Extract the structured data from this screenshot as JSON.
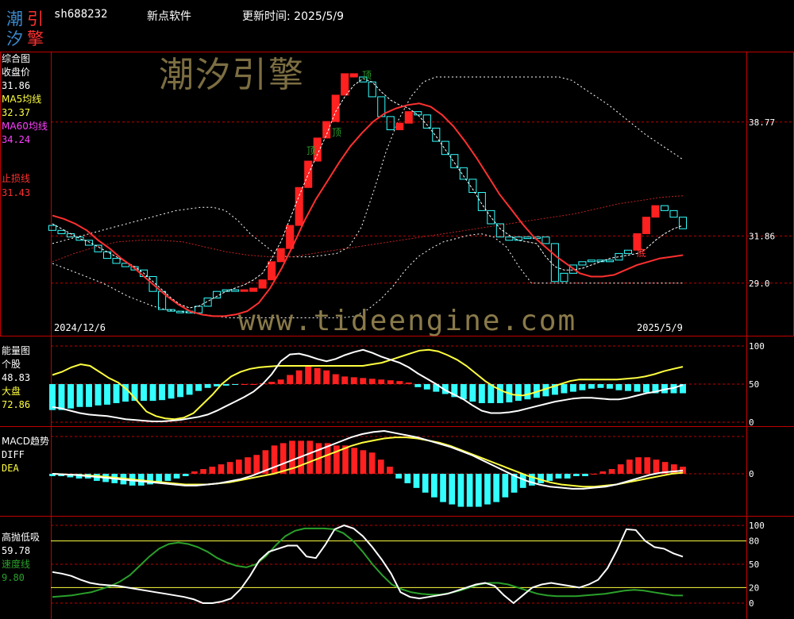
{
  "header": {
    "logo_chars": [
      "潮",
      "引",
      "汐",
      "擎"
    ],
    "code": "sh688232",
    "software": "新点软件",
    "update_label": "更新时间: 2025/5/9"
  },
  "watermarks": {
    "cn": "潮汐引擎",
    "url": "www.tideengine.com"
  },
  "colors": {
    "up": "#ff2020",
    "down": "#33ffff",
    "ma5": "#ffff40",
    "ma60": "#ff3030",
    "grid": "#c00000",
    "white": "#ffffff",
    "green": "#2aa02a"
  },
  "panels": {
    "main": {
      "title": "综合图",
      "close_label": "收盘价",
      "close_value": "31.86",
      "ma5_label": "MA5均线",
      "ma5_value": "32.37",
      "ma60_label": "MA60均线",
      "ma60_value": "34.24",
      "stop_label": "止损线",
      "stop_value": "31.43",
      "date_start": "2024/12/6",
      "date_end": "2025/5/9",
      "top_marks": [
        "顶",
        "顶",
        "顶"
      ],
      "bottom_mark": "底"
    },
    "energy": {
      "title": "能量图",
      "stock_label": "个股",
      "stock_value": "48.83",
      "market_label": "大盘",
      "market_value": "72.86"
    },
    "macd": {
      "title": "MACD趋势",
      "diff_label": "DIFF",
      "dea_label": "DEA"
    },
    "kdj": {
      "title": "高抛低吸",
      "value": "59.78",
      "speed_label": "速度线",
      "speed_value": "9.80"
    }
  },
  "chart_data": [
    {
      "type": "candlestick",
      "name_hint": "main",
      "x": [
        "2024/12/6",
        "2025/5/9"
      ],
      "y_ticks": [
        38.77,
        31.86,
        29.0
      ],
      "ylim": [
        26.2,
        42.8
      ],
      "close": [
        32.2,
        32.0,
        31.8,
        31.6,
        31.3,
        30.9,
        30.5,
        30.2,
        30.0,
        29.8,
        29.4,
        28.5,
        27.4,
        27.3,
        27.3,
        27.2,
        27.6,
        28.1,
        28.5,
        28.6,
        28.6,
        28.5,
        28.7,
        29.2,
        30.3,
        31.1,
        32.5,
        34.8,
        36.4,
        37.8,
        38.8,
        40.4,
        41.7,
        41.5,
        41.2,
        40.3,
        39.1,
        38.3,
        38.7,
        39.4,
        39.2,
        38.4,
        37.6,
        36.8,
        36.0,
        35.3,
        34.5,
        33.4,
        32.6,
        31.8,
        31.6,
        31.8,
        31.8,
        31.8,
        31.4,
        29.1,
        29.6,
        30.1,
        30.3,
        30.4,
        30.3,
        30.4,
        30.8,
        31.0,
        32.0,
        33.0,
        33.7,
        33.4,
        33.0,
        32.3
      ],
      "up_index": [
        21,
        22,
        23,
        24,
        25,
        26,
        27,
        28,
        29,
        30,
        31,
        32,
        33,
        38,
        39,
        64,
        65,
        66
      ],
      "ma5": [
        32.6,
        32.3,
        32.0,
        31.7,
        31.5,
        31.2,
        30.9,
        30.6,
        30.3,
        30.0,
        29.6,
        29.1,
        28.6,
        28.1,
        27.7,
        27.5,
        27.6,
        27.9,
        28.2,
        28.5,
        28.7,
        28.9,
        29.2,
        29.6,
        30.5,
        31.5,
        32.9,
        34.3,
        35.6,
        36.8,
        38.0,
        39.4,
        40.3,
        41.0,
        41.4,
        41.2,
        40.6,
        40.1,
        39.8,
        39.6,
        39.2,
        38.6,
        37.9,
        37.1,
        36.3,
        35.5,
        34.7,
        33.8,
        33.0,
        32.3,
        31.9,
        31.6,
        31.5,
        31.4,
        30.6,
        30.0,
        29.8,
        29.8,
        29.9,
        30.1,
        30.3,
        30.5,
        30.6,
        30.7,
        30.8,
        31.1,
        31.6,
        32.0,
        32.3,
        32.5
      ],
      "ma60": [
        33.1,
        32.9,
        32.6,
        32.2,
        31.6,
        31.1,
        30.5,
        30.0,
        29.4,
        28.8,
        28.2,
        27.7,
        27.3,
        27.1,
        27.0,
        27.0,
        27.1,
        27.3,
        27.8,
        28.7,
        29.9,
        31.3,
        32.8,
        34.1,
        35.2,
        36.3,
        37.3,
        38.1,
        38.8,
        39.3,
        39.6,
        39.8,
        39.9,
        39.7,
        39.2,
        38.5,
        37.6,
        36.6,
        35.5,
        34.4,
        33.5,
        32.6,
        31.8,
        31.2,
        30.6,
        30.1,
        29.6,
        29.4,
        29.4,
        29.5,
        29.8,
        30.1,
        30.3,
        30.5,
        30.6,
        30.7
      ],
      "upper_band": [
        31.4,
        31.6,
        31.8,
        32.0,
        32.2,
        32.4,
        32.6,
        32.8,
        33.0,
        33.2,
        33.4,
        33.5,
        33.6,
        33.6,
        33.4,
        32.8,
        32.0,
        31.4,
        30.8,
        30.6,
        30.6,
        30.6,
        30.7,
        30.8,
        31.2,
        32.4,
        34.6,
        37.0,
        38.9,
        40.3,
        41.2,
        41.5,
        41.5,
        41.5,
        41.5,
        41.5,
        41.5,
        41.5,
        41.5,
        41.5,
        41.5,
        41.5,
        41.3,
        40.8,
        40.3,
        39.8,
        39.2,
        38.6,
        38.0,
        37.5,
        37.0,
        36.5
      ],
      "lower_band": [
        30.2,
        29.9,
        29.6,
        29.3,
        29.0,
        28.6,
        28.2,
        27.9,
        27.6,
        27.4,
        27.3,
        27.2,
        27.1,
        27.0,
        26.9,
        26.9,
        26.9,
        26.9,
        26.9,
        26.9,
        26.9,
        26.9,
        26.9,
        26.9,
        27.0,
        27.4,
        28.0,
        28.8,
        29.8,
        30.6,
        31.1,
        31.5,
        31.7,
        31.9,
        32.0,
        31.8,
        31.2,
        30.0,
        29.0,
        29.0,
        29.0,
        29.0,
        29.0,
        29.0,
        29.0,
        29.0,
        29.0,
        29.0,
        29.0,
        29.0,
        29.0
      ],
      "ma_long": [
        30.3,
        30.8,
        31.2,
        31.5,
        31.6,
        31.6,
        31.5,
        31.2,
        30.9,
        30.7,
        30.6,
        30.6,
        30.8,
        31.0,
        31.2,
        31.4,
        31.6,
        31.8,
        32.0,
        32.2,
        32.4,
        32.6,
        32.8,
        33.0,
        33.2,
        33.5,
        33.8,
        34.0,
        34.2,
        34.3
      ]
    },
    {
      "type": "bar+line",
      "name_hint": "energy",
      "y_ticks": [
        100,
        50,
        0
      ],
      "ylim": [
        0,
        100
      ],
      "bars": [
        -34,
        -34,
        -32,
        -30,
        -30,
        -28,
        -27,
        -25,
        -23,
        -22,
        -22,
        -22,
        -21,
        -19,
        -17,
        -14,
        -9,
        -5,
        -3,
        -2,
        -1,
        0,
        0,
        1,
        3,
        6,
        12,
        18,
        23,
        21,
        18,
        13,
        10,
        9,
        8,
        7,
        6,
        5,
        4,
        2,
        -4,
        -7,
        -10,
        -13,
        -17,
        -20,
        -23,
        -25,
        -25,
        -25,
        -24,
        -22,
        -20,
        -18,
        -16,
        -14,
        -12,
        -10,
        -8,
        -6,
        -5,
        -6,
        -8,
        -9,
        -10,
        -11,
        -12,
        -12,
        -12,
        -12
      ],
      "stock": [
        20,
        18,
        15,
        12,
        10,
        9,
        8,
        6,
        4,
        3,
        2,
        1,
        1,
        2,
        3,
        5,
        7,
        10,
        15,
        21,
        27,
        33,
        40,
        50,
        63,
        80,
        89,
        90,
        87,
        83,
        80,
        83,
        88,
        92,
        95,
        91,
        86,
        82,
        78,
        72,
        64,
        57,
        50,
        42,
        36,
        30,
        22,
        15,
        12,
        12,
        13,
        15,
        18,
        21,
        24,
        27,
        29,
        31,
        32,
        32,
        31,
        30,
        30,
        32,
        35,
        38,
        40,
        43,
        45,
        48.83
      ],
      "market": [
        62,
        66,
        72,
        76,
        74,
        66,
        58,
        52,
        42,
        28,
        14,
        8,
        5,
        4,
        6,
        12,
        24,
        36,
        50,
        60,
        66,
        70,
        72,
        73,
        74,
        74,
        74,
        74,
        74,
        74,
        74,
        74,
        74,
        74,
        76,
        78,
        82,
        86,
        90,
        94,
        95,
        93,
        88,
        82,
        74,
        64,
        54,
        46,
        40,
        36,
        35,
        38,
        42,
        46,
        50,
        54,
        56,
        56,
        56,
        56,
        56,
        57,
        58,
        60,
        63,
        67,
        70,
        72.86
      ]
    },
    {
      "type": "bar+line",
      "name_hint": "macd",
      "y_ticks": [
        0
      ],
      "bars": [
        -1,
        -1,
        -1.5,
        -2,
        -2,
        -3,
        -3.5,
        -4,
        -4.5,
        -5,
        -5,
        -4.5,
        -4,
        -3,
        -2,
        -1,
        1,
        2,
        3,
        4,
        5,
        6,
        7,
        8,
        10,
        12,
        13,
        14,
        14,
        14,
        13,
        13,
        12,
        12,
        11,
        10,
        9,
        6,
        3,
        -2,
        -4,
        -6,
        -8,
        -10,
        -12,
        -13,
        -14,
        -14,
        -14,
        -13,
        -12,
        -10,
        -8,
        -6,
        -5,
        -4,
        -3,
        -2,
        -2,
        -1,
        -1,
        0,
        1,
        2,
        4,
        6,
        7,
        7,
        6,
        5,
        4,
        3
      ],
      "diff": [
        0,
        -0.5,
        -1,
        -2,
        -3,
        -4,
        -5,
        -6,
        -7,
        -8,
        -9,
        -10,
        -11,
        -11,
        -10,
        -9,
        -7,
        -5,
        -2,
        2,
        6,
        10,
        14,
        18,
        22,
        26,
        30,
        34,
        37,
        39,
        40,
        38,
        36,
        34,
        31,
        28,
        25,
        21,
        17,
        12,
        7,
        2,
        -3,
        -7,
        -10,
        -12,
        -13,
        -14,
        -14,
        -13,
        -12,
        -10,
        -7,
        -4,
        -1,
        1,
        2,
        3
      ],
      "dea": [
        0,
        -0.5,
        -1,
        -1.5,
        -2,
        -3,
        -4,
        -5,
        -6,
        -7,
        -8,
        -9,
        -10,
        -10,
        -10,
        -9,
        -8,
        -6,
        -4,
        -2,
        0,
        3,
        6,
        10,
        14,
        18,
        22,
        26,
        29,
        31,
        33,
        34,
        34,
        33,
        31,
        29,
        26,
        22,
        18,
        14,
        10,
        6,
        2,
        -2,
        -5,
        -8,
        -10,
        -11,
        -12,
        -12,
        -11,
        -10,
        -8,
        -6,
        -4,
        -2,
        0,
        1
      ]
    },
    {
      "type": "line",
      "name_hint": "kdj",
      "y_ticks": [
        100,
        80,
        50,
        20,
        0
      ],
      "ylim": [
        0,
        100
      ],
      "white": [
        40,
        38,
        35,
        30,
        26,
        24,
        23,
        22,
        20,
        18,
        16,
        14,
        12,
        10,
        8,
        5,
        0,
        0,
        2,
        6,
        18,
        35,
        55,
        66,
        70,
        74,
        74,
        60,
        58,
        75,
        95,
        100,
        96,
        86,
        72,
        56,
        38,
        14,
        8,
        6,
        8,
        10,
        12,
        16,
        20,
        24,
        26,
        22,
        10,
        0,
        10,
        20,
        24,
        26,
        24,
        22,
        20,
        24,
        30,
        45,
        68,
        95,
        94,
        80,
        72,
        70,
        64,
        59.78
      ],
      "green": [
        8,
        9,
        10,
        12,
        14,
        18,
        22,
        28,
        36,
        48,
        60,
        70,
        76,
        78,
        76,
        72,
        66,
        58,
        52,
        48,
        46,
        50,
        60,
        74,
        86,
        93,
        96,
        96,
        96,
        95,
        90,
        80,
        66,
        50,
        36,
        24,
        18,
        14,
        12,
        11,
        11,
        13,
        16,
        20,
        24,
        26,
        26,
        24,
        20,
        16,
        12,
        10,
        9,
        9,
        9,
        10,
        11,
        12,
        14,
        16,
        17,
        16,
        14,
        12,
        10,
        9.8
      ]
    }
  ]
}
